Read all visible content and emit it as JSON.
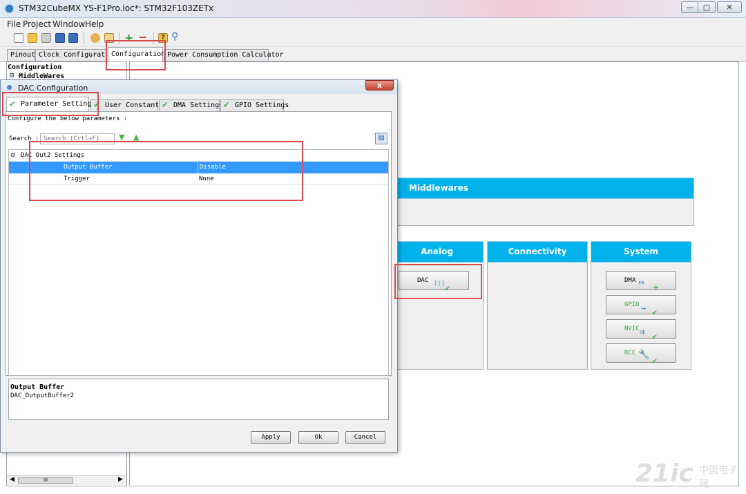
{
  "window": {
    "title": "STM32CubeMX YS-F1Pro.ioc*: STM32F103ZETx"
  },
  "menu": [
    "File",
    "Project",
    "Window",
    "Help"
  ],
  "main_tabs": [
    "Pinout",
    "Clock Configuration",
    "Configuration",
    "Power Consumption Calculator"
  ],
  "tree": {
    "root": "Configuration",
    "middlewares": "MiddleWares"
  },
  "categories": {
    "middlewares": "Middlewares",
    "analog": "Analog",
    "connectivity": "Connectivity",
    "system": "System"
  },
  "peripherals": {
    "analog": [
      {
        "label": "DAC",
        "icon": "waveform-icon",
        "status": "ok"
      }
    ],
    "system": [
      {
        "label": "DMA",
        "icon": "dma-icon",
        "status": "add"
      },
      {
        "label": "GPIO",
        "icon": "arrow-right-icon",
        "status": "ok"
      },
      {
        "label": "NVIC",
        "icon": "interrupt-icon",
        "status": "ok"
      },
      {
        "label": "RCC",
        "icon": "wrench-icon",
        "status": "ok"
      }
    ]
  },
  "dialog": {
    "title": "DAC Configuration",
    "close": "x",
    "tabs": [
      "Parameter Settings",
      "User Constants",
      "DMA Settings",
      "GPIO Settings"
    ],
    "instructions": "Configure the below parameters :",
    "search_label": "Search :",
    "search_placeholder": "Search (Crtl+F)",
    "group": "DAC Out2 Settings",
    "params": [
      {
        "name": "Output Buffer",
        "value": "Disable"
      },
      {
        "name": "Trigger",
        "value": "None"
      }
    ],
    "description": {
      "title": "Output Buffer",
      "text": "DAC_OutputBuffer2"
    },
    "buttons": {
      "apply": "Apply",
      "ok": "Ok",
      "cancel": "Cancel"
    }
  },
  "scrollbar": {
    "thumb": "III"
  },
  "watermark": {
    "latin": "21ic",
    "cn": "中国电子网"
  },
  "colors": {
    "category_header": "#00b2e9",
    "selection": "#3399ff",
    "annotation": "#d94a4a",
    "check": "#3fb54a"
  }
}
